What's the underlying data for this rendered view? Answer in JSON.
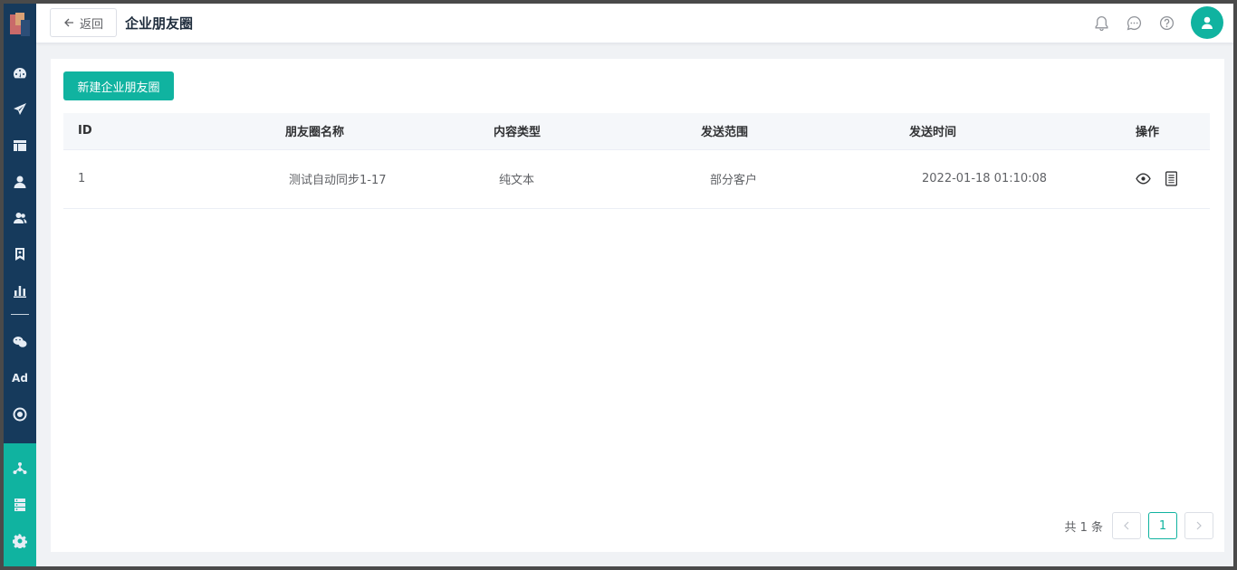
{
  "header": {
    "back_label": "返回",
    "title": "企业朋友圈"
  },
  "toolbar": {
    "create_label": "新建企业朋友圈"
  },
  "table": {
    "columns": [
      "ID",
      "朋友圈名称",
      "内容类型",
      "发送范围",
      "发送时间",
      "操作"
    ],
    "rows": [
      {
        "id": "1",
        "name": "测试自动同步1-17",
        "content_type": "纯文本",
        "scope": "部分客户",
        "send_time": "2022-01-18 01:10:08"
      }
    ]
  },
  "pagination": {
    "total_text": "共 1 条",
    "current_page": "1"
  },
  "sidebar": {
    "ad_label": "Ad",
    "icons": [
      "dashboard-icon",
      "send-icon",
      "layout-icon",
      "user-icon",
      "users-icon",
      "bookmark-icon",
      "chart-icon",
      "wechat-icon",
      "ad-icon",
      "target-icon",
      "share-icon",
      "server-icon",
      "gear-icon"
    ]
  },
  "colors": {
    "accent": "#10b3a0",
    "sidebar": "#163a5c"
  }
}
